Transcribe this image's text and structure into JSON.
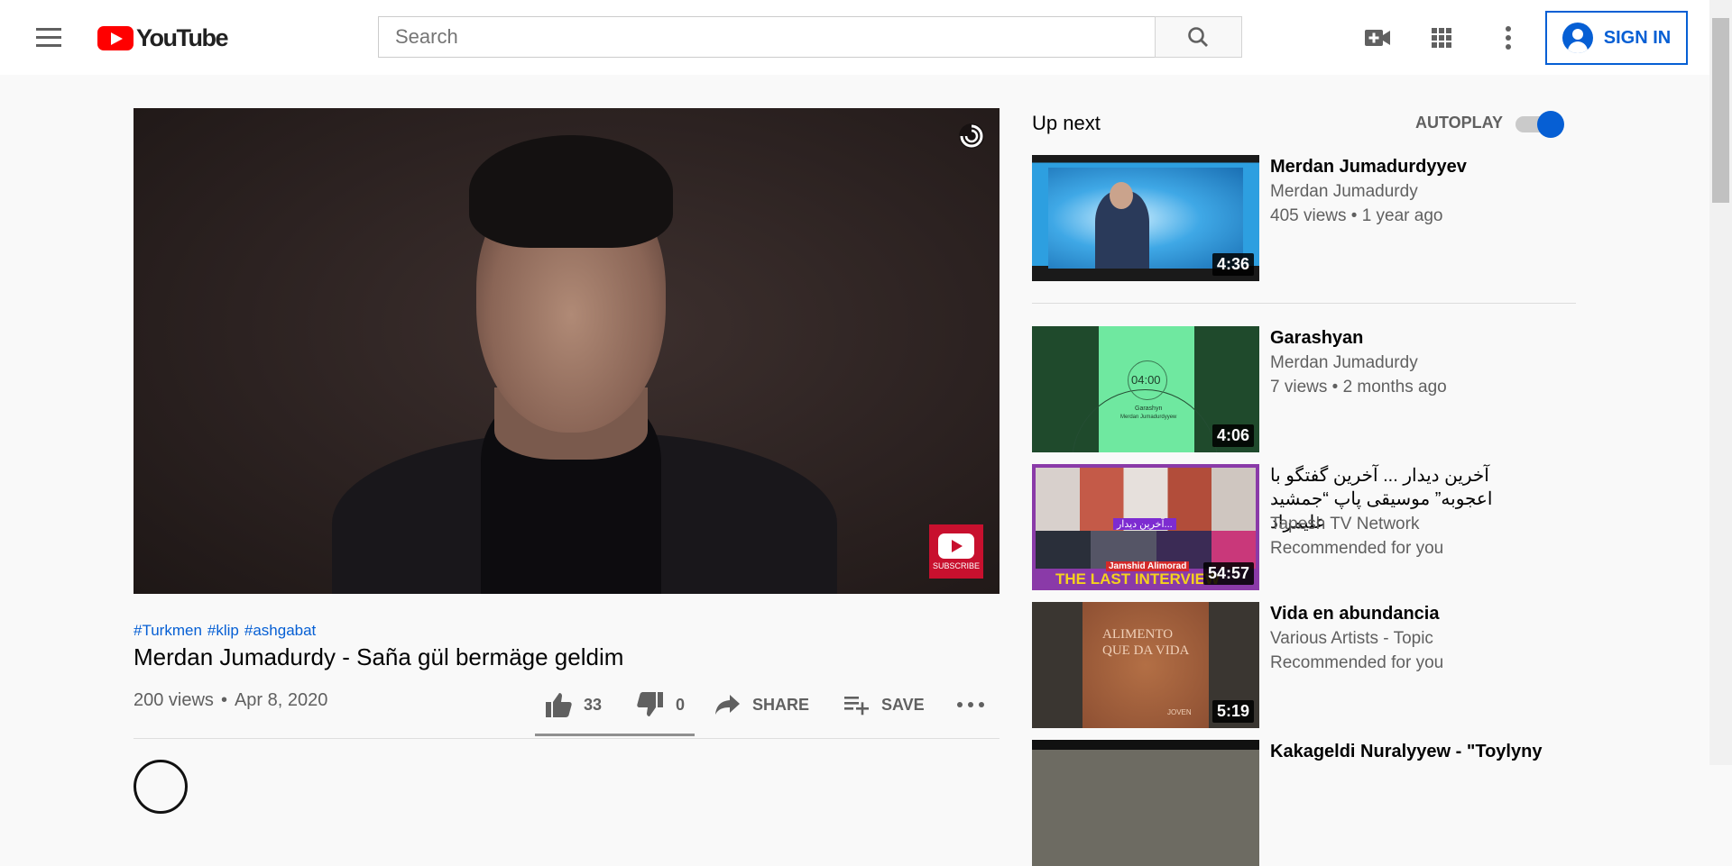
{
  "header": {
    "logo_text": "YouTube",
    "search_placeholder": "Search",
    "search_value": "",
    "signin_label": "SIGN IN"
  },
  "video": {
    "hashtags": [
      "#Turkmen",
      "#klip",
      "#ashgabat"
    ],
    "title": "Merdan Jumadurdy - Saña gül bermäge geldim",
    "views": "200 views",
    "date": "Apr 8, 2020",
    "likes": "33",
    "dislikes": "0",
    "share_label": "SHARE",
    "save_label": "SAVE",
    "watermark_text": "SUBSCRIBE",
    "like_fraction": 1.0
  },
  "sidebar": {
    "up_next_label": "Up next",
    "autoplay_label": "AUTOPLAY",
    "autoplay_on": true,
    "items": [
      {
        "title": "Merdan Jumadurdyyev",
        "channel": "Merdan Jumadurdy",
        "meta": "405 views • 1 year ago",
        "duration": "4:36"
      },
      {
        "title": "Garashyan",
        "channel": "Merdan Jumadurdy",
        "meta": "7 views • 2 months ago",
        "duration": "4:06",
        "thumb_time": "04:00",
        "thumb_caption_1": "Garashyn",
        "thumb_caption_2": "Merdan Jumadurdyyew"
      },
      {
        "title": "آخرین دیدار ... آخرین گفتگو با اعجوبه” موسیقی پاپ “جمشید علیمراد",
        "channel": "Tapesh TV Network",
        "meta": "Recommended for you",
        "duration": "54:57",
        "thumb_tag": "آخرین دیدار...",
        "thumb_name": "Jamshid Alimorad",
        "thumb_banner": "THE LAST INTERVIEW"
      },
      {
        "title": "Vida en abundancia",
        "channel": "Various Artists - Topic",
        "meta": "Recommended for you",
        "duration": "5:19",
        "thumb_line_1": "ALIMENTO",
        "thumb_line_2": "QUE DA VIDA",
        "thumb_brand": "JOVEN"
      },
      {
        "title": "Kakageldi Nuralyyew - \"Toylyny",
        "channel": "",
        "meta": "",
        "duration": ""
      }
    ]
  },
  "colors": {
    "brand_red": "#ff0000",
    "link_blue": "#065fd4",
    "text_secondary": "#606060"
  }
}
